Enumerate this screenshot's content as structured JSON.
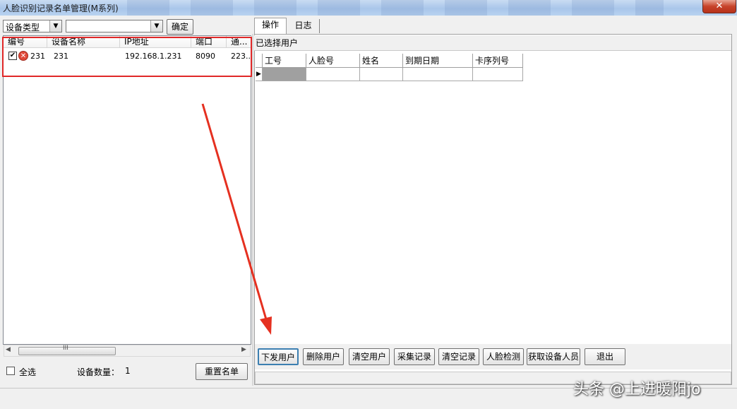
{
  "window": {
    "title": "人脸识别记录名单管理(M系列)",
    "close_glyph": "✕"
  },
  "filter": {
    "device_type_value": "设备类型",
    "second_value": "",
    "ok_label": "确定"
  },
  "device_list": {
    "columns": [
      "编号",
      "设备名称",
      "IP地址",
      "端口",
      "通..."
    ],
    "rows": [
      {
        "checked": true,
        "status_icon": "error-icon",
        "id": "231",
        "name": "231",
        "ip": "192.168.1.231",
        "port": "8090",
        "extra": "223..."
      }
    ],
    "scroll_grip": "III"
  },
  "left_footer": {
    "select_all_label": "全选",
    "device_count_label": "设备数量：",
    "device_count_value": "1",
    "reset_label": "重置名单"
  },
  "tabs": [
    "操作",
    "日志"
  ],
  "selected_users": {
    "title": "已选择用户",
    "columns": [
      "工号",
      "人脸号",
      "姓名",
      "到期日期",
      "卡序列号"
    ]
  },
  "actions": [
    "下发用户",
    "删除用户",
    "清空用户",
    "采集记录",
    "清空记录",
    "人脸检测",
    "获取设备人员",
    "退出"
  ],
  "watermark": "头条 @上进暖阳jo",
  "colors": {
    "highlight": "#e02828",
    "titlebar": "#a9c6ea"
  }
}
